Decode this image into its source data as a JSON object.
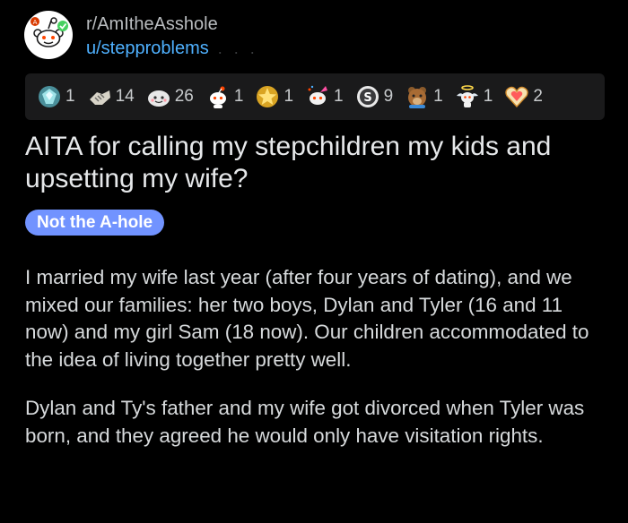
{
  "post": {
    "subreddit": "r/AmItheAsshole",
    "username": "u/stepproblems",
    "username_suffix": ". . .",
    "title": "AITA for calling my stepchildren my kids and upsetting my wife?",
    "flair": "Not the A-hole",
    "paragraphs": [
      "I married my wife last year (after four years of dating), and we mixed our families: her two boys, Dylan and Tyler (16 and 11 now) and my girl Sam (18 now). Our children accommodated to the idea of living together pretty well.",
      "Dylan and Ty's father and my wife got divorced when Tyler was born, and they agreed he would only have visitation rights."
    ]
  },
  "awards": [
    {
      "icon": "gem-award-icon",
      "count": "1"
    },
    {
      "icon": "handshake-award-icon",
      "count": "14"
    },
    {
      "icon": "wholesome-award-icon",
      "count": "26"
    },
    {
      "icon": "snoo-award-icon",
      "count": "1"
    },
    {
      "icon": "gold-star-award-icon",
      "count": "1"
    },
    {
      "icon": "party-snoo-award-icon",
      "count": "1"
    },
    {
      "icon": "silver-coin-award-icon",
      "count": "9"
    },
    {
      "icon": "bear-award-icon",
      "count": "1"
    },
    {
      "icon": "angel-award-icon",
      "count": "1"
    },
    {
      "icon": "heart-award-icon",
      "count": "2"
    }
  ],
  "colors": {
    "background": "#000000",
    "award_bar": "#1a1a1b",
    "username": "#4fb1ff",
    "flair": "#7193ff",
    "text": "#d7dadc"
  }
}
